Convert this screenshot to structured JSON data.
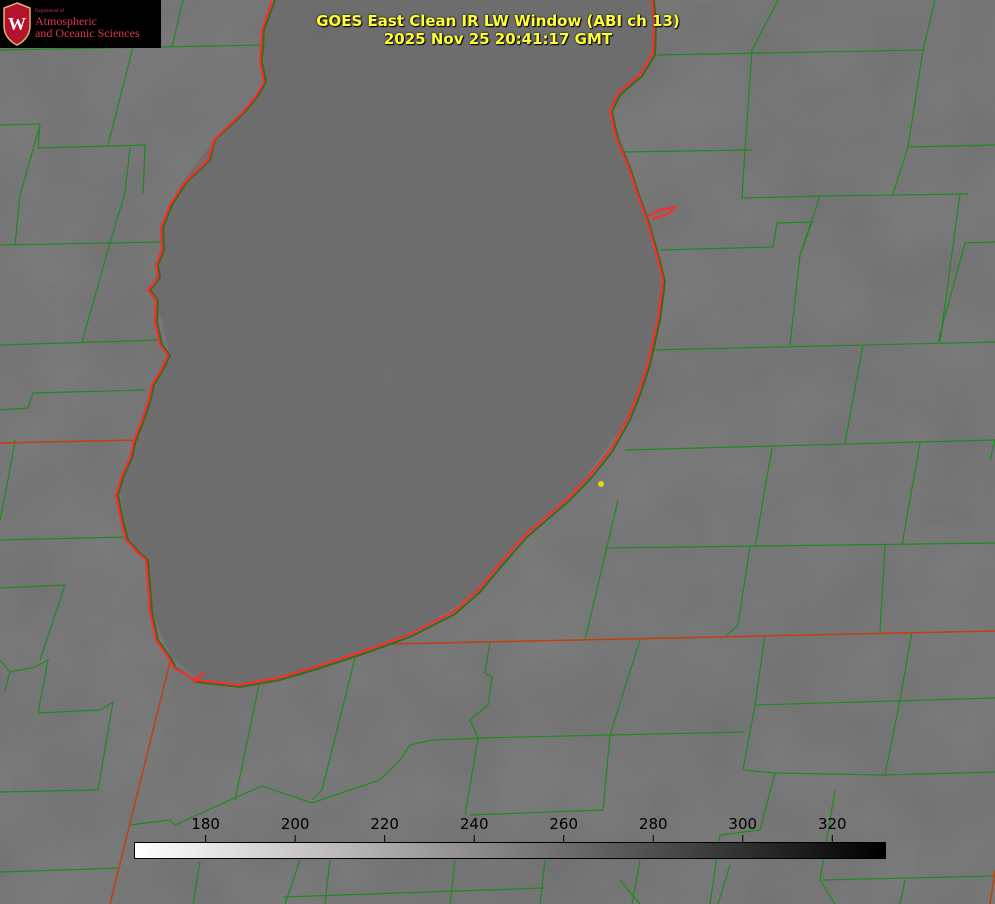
{
  "header": {
    "title": "GOES East Clean IR LW Window (ABI ch 13)",
    "timestamp": "2025 Nov 25 20:41:17 GMT"
  },
  "logo": {
    "department": "Department of",
    "line1": "Atmospheric",
    "line2": "and Oceanic Sciences",
    "seal_letter": "W"
  },
  "colorbar": {
    "ticks": [
      "180",
      "200",
      "220",
      "240",
      "260",
      "280",
      "300",
      "320"
    ],
    "tick_values": [
      180,
      200,
      220,
      240,
      260,
      280,
      300,
      320
    ],
    "range": [
      164,
      332
    ],
    "gradient": "white to black"
  },
  "colors": {
    "county_lines": "#1f8a1f",
    "coastline": "#ff2a2a",
    "state_lines": "#c04010",
    "title_text": "#ffff33",
    "marker": "#e6d21a",
    "logo_text": "#e2344e"
  }
}
